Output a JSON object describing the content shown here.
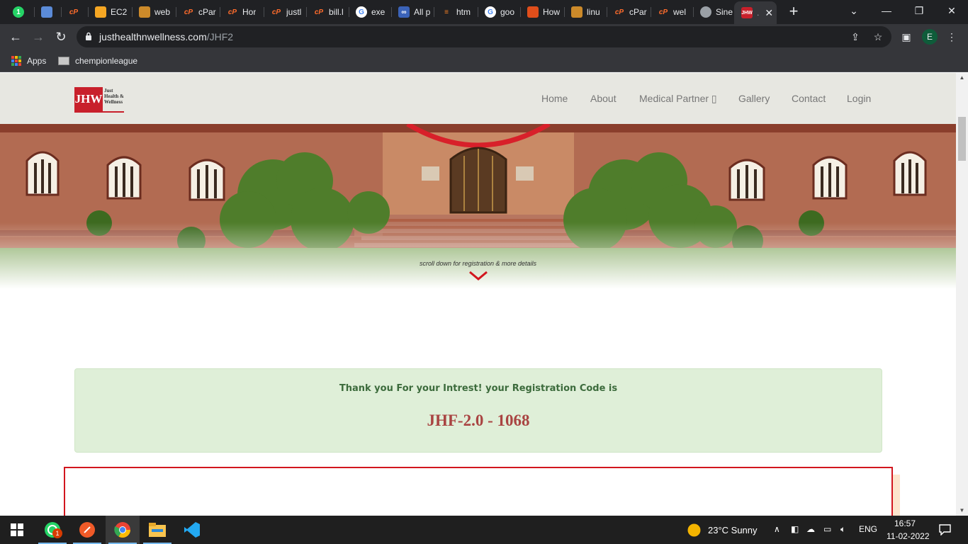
{
  "browser": {
    "tabs": [
      {
        "title": "",
        "icon": "whatsapp-icon",
        "color": "#25d366"
      },
      {
        "title": "",
        "icon": "vpn-icon",
        "color": "#5b8bd8"
      },
      {
        "title": "",
        "icon": "cpanel-icon",
        "color": "#ff6c2c"
      },
      {
        "title": "EC2",
        "icon": "aws-box-icon",
        "color": "#f5a623"
      },
      {
        "title": "web",
        "icon": "shortcut-icon",
        "color": "#cc8a2a"
      },
      {
        "title": "cPar",
        "icon": "cpanel-icon",
        "color": "#ff6c2c"
      },
      {
        "title": "Hor",
        "icon": "cpanel-icon",
        "color": "#ff6c2c"
      },
      {
        "title": "justl",
        "icon": "cpanel-icon",
        "color": "#ff6c2c"
      },
      {
        "title": "bill.l",
        "icon": "cpanel-icon",
        "color": "#ff6c2c"
      },
      {
        "title": "exe",
        "icon": "google-icon",
        "color": "#ffffff"
      },
      {
        "title": "All p",
        "icon": "infinity-icon",
        "color": "#3b63b8"
      },
      {
        "title": "htm",
        "icon": "stackoverflow-icon",
        "color": "#f48024"
      },
      {
        "title": "goo",
        "icon": "google-icon",
        "color": "#ffffff"
      },
      {
        "title": "How",
        "icon": "tutorial-icon",
        "color": "#e04e1b"
      },
      {
        "title": "linu",
        "icon": "shortcut-icon",
        "color": "#cc8a2a"
      },
      {
        "title": "cPar",
        "icon": "cpanel-icon",
        "color": "#ff6c2c"
      },
      {
        "title": "wel",
        "icon": "cpanel-icon",
        "color": "#ff6c2c"
      },
      {
        "title": "Sine",
        "icon": "globe-icon",
        "color": "#9aa0a6"
      },
      {
        "title": "",
        "icon": "jhw-icon",
        "color": "#c8202b"
      }
    ],
    "url_host": "justhealthnwellness.com",
    "url_path": "/JHF2",
    "profile_initial": "E",
    "bookmarks": [
      "Apps",
      "chempionleague"
    ]
  },
  "site": {
    "logo_mark": "JHW",
    "logo_text": [
      "Just",
      "Health &",
      "Wellness"
    ],
    "nav": [
      "Home",
      "About",
      "Medical Partner ▯",
      "Gallery",
      "Contact",
      "Login"
    ],
    "scroll_hint": "scroll down for registration & more details",
    "alert_message": "Thank you For your Intrest! your Registration Code is",
    "registration_code": "JHF-2.0 - 1068"
  },
  "taskbar": {
    "whatsapp_badge": "1",
    "weather": "23°C  Sunny",
    "language": "ENG",
    "time": "16:57",
    "date": "11-02-2022"
  }
}
